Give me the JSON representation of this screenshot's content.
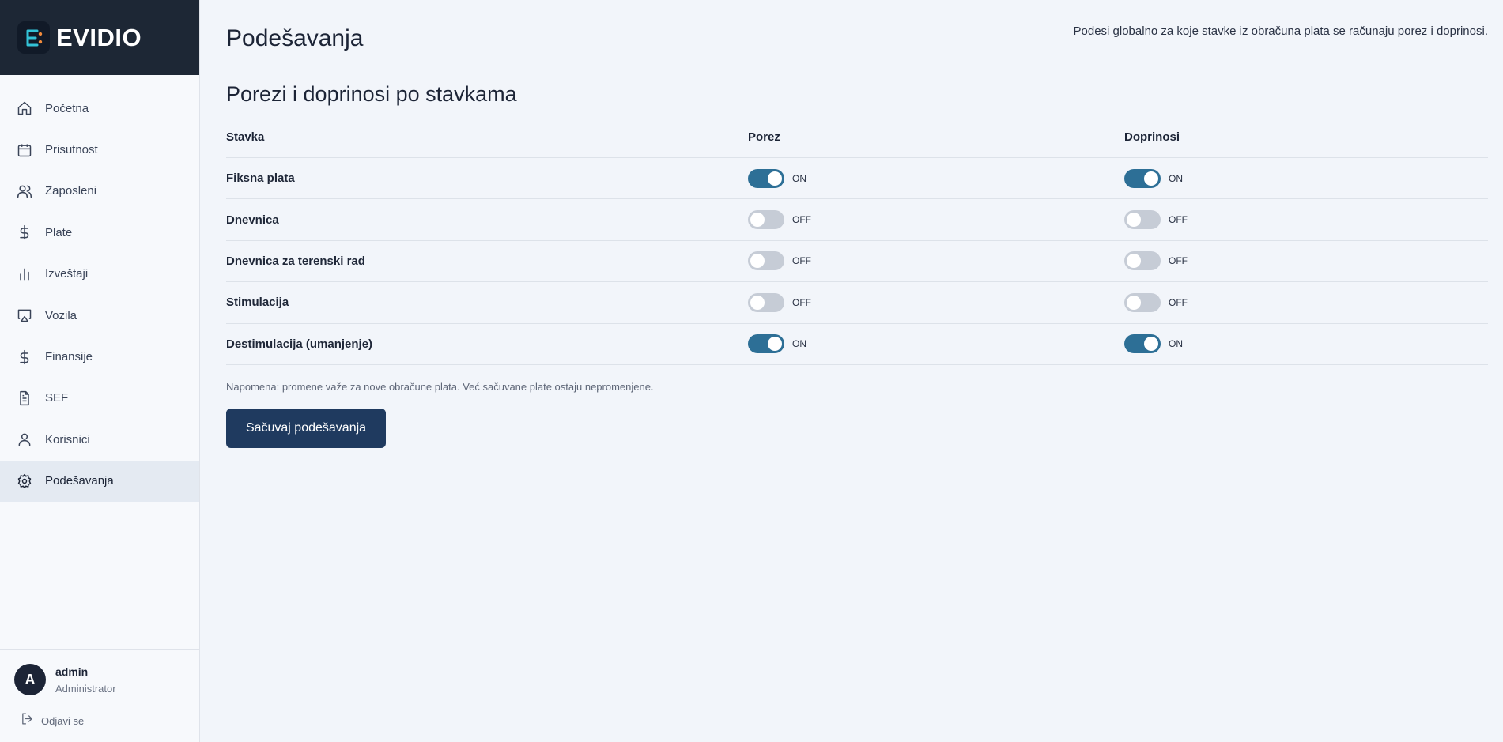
{
  "brand": {
    "name": "EVIDIO"
  },
  "sidebar": {
    "items": [
      {
        "label": "Početna",
        "icon": "home-icon",
        "active": false
      },
      {
        "label": "Prisutnost",
        "icon": "calendar-icon",
        "active": false
      },
      {
        "label": "Zaposleni",
        "icon": "users-icon",
        "active": false
      },
      {
        "label": "Plate",
        "icon": "dollar-icon",
        "active": false
      },
      {
        "label": "Izveštaji",
        "icon": "bar-chart-icon",
        "active": false
      },
      {
        "label": "Vozila",
        "icon": "monitor-icon",
        "active": false
      },
      {
        "label": "Finansije",
        "icon": "dollar-icon",
        "active": false
      },
      {
        "label": "SEF",
        "icon": "document-icon",
        "active": false
      },
      {
        "label": "Korisnici",
        "icon": "user-icon",
        "active": false
      },
      {
        "label": "Podešavanja",
        "icon": "gear-icon",
        "active": true
      }
    ]
  },
  "user": {
    "initial": "A",
    "name": "admin",
    "role": "Administrator",
    "logout_label": "Odjavi se"
  },
  "page": {
    "title": "Podešavanja",
    "description": "Podesi globalno za koje stavke iz obračuna plata se računaju porez i doprinosi.",
    "section_title": "Porezi i doprinosi po stavkama",
    "table": {
      "headers": {
        "item": "Stavka",
        "tax": "Porez",
        "contrib": "Doprinosi"
      },
      "rows": [
        {
          "name": "Fiksna plata",
          "tax": true,
          "tax_label": "ON",
          "contrib": true,
          "contrib_label": "ON"
        },
        {
          "name": "Dnevnica",
          "tax": false,
          "tax_label": "OFF",
          "contrib": false,
          "contrib_label": "OFF"
        },
        {
          "name": "Dnevnica za terenski rad",
          "tax": false,
          "tax_label": "OFF",
          "contrib": false,
          "contrib_label": "OFF"
        },
        {
          "name": "Stimulacija",
          "tax": false,
          "tax_label": "OFF",
          "contrib": false,
          "contrib_label": "OFF"
        },
        {
          "name": "Destimulacija (umanjenje)",
          "tax": true,
          "tax_label": "ON",
          "contrib": true,
          "contrib_label": "ON"
        }
      ]
    },
    "note": "Napomena: promene važe za nove obračune plata. Već sačuvane plate ostaju nepromenjene.",
    "save_label": "Sačuvaj podešavanja"
  },
  "colors": {
    "accent": "#2d6f96",
    "sidebar_header": "#1d2735",
    "button": "#1f3a5f",
    "toggle_off": "#c6ccd6"
  }
}
